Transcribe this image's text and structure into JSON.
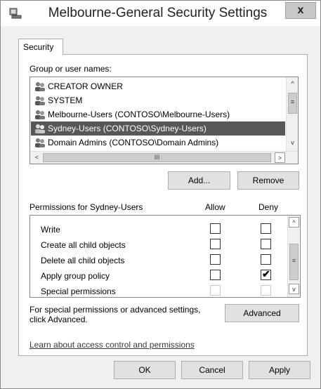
{
  "window": {
    "title": "Melbourne-General Security Settings",
    "close_glyph": "x"
  },
  "tabs": [
    {
      "label": "Security"
    }
  ],
  "group_list": {
    "label": "Group or user names:",
    "items": [
      {
        "name": "CREATOR OWNER",
        "selected": false
      },
      {
        "name": "SYSTEM",
        "selected": false
      },
      {
        "name": "Melbourne-Users (CONTOSO\\Melbourne-Users)",
        "selected": false
      },
      {
        "name": "Sydney-Users (CONTOSO\\Sydney-Users)",
        "selected": true
      },
      {
        "name": "Domain Admins (CONTOSO\\Domain Admins)",
        "selected": false
      }
    ]
  },
  "buttons": {
    "add": "Add...",
    "remove": "Remove",
    "advanced": "Advanced",
    "ok": "OK",
    "cancel": "Cancel",
    "apply": "Apply"
  },
  "permissions": {
    "header": "Permissions for Sydney-Users",
    "allow_header": "Allow",
    "deny_header": "Deny",
    "rows": [
      {
        "name": "Write",
        "allow": false,
        "deny": false,
        "disabled": false
      },
      {
        "name": "Create all child objects",
        "allow": false,
        "deny": false,
        "disabled": false
      },
      {
        "name": "Delete all child objects",
        "allow": false,
        "deny": false,
        "disabled": false
      },
      {
        "name": "Apply group policy",
        "allow": false,
        "deny": true,
        "disabled": false
      },
      {
        "name": "Special permissions",
        "allow": false,
        "deny": false,
        "disabled": true
      }
    ]
  },
  "advanced_text": "For special permissions or advanced settings, click Advanced.",
  "link": "Learn about access control and permissions",
  "scroll_glyphs": {
    "up": "^",
    "down": "v",
    "left": "<",
    "right": ">",
    "grip_v": "≡",
    "grip_h": "III"
  }
}
